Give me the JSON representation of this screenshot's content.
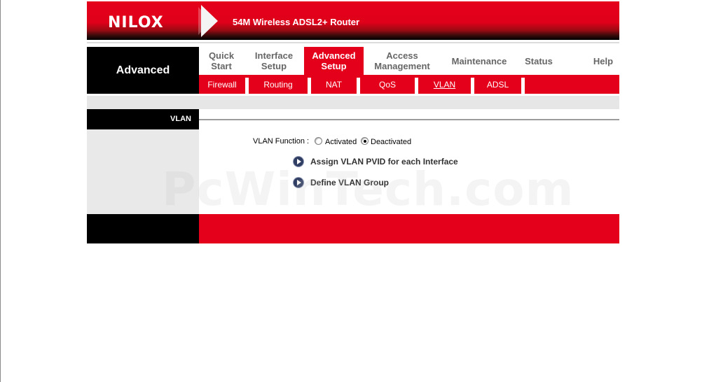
{
  "header": {
    "brand": "NILOX",
    "product": "54M Wireless ADSL2+ Router"
  },
  "section_title": "Advanced",
  "nav": {
    "tabs": [
      {
        "label": "Quick\nStart",
        "active": false
      },
      {
        "label": "Interface\nSetup",
        "active": false
      },
      {
        "label": "Advanced\nSetup",
        "active": true
      },
      {
        "label": "Access\nManagement",
        "active": false
      },
      {
        "label": "Maintenance",
        "active": false
      },
      {
        "label": "Status",
        "active": false
      },
      {
        "label": "Help",
        "active": false
      }
    ],
    "subtabs": [
      {
        "label": "Firewall",
        "active": false
      },
      {
        "label": "Routing",
        "active": false
      },
      {
        "label": "NAT",
        "active": false
      },
      {
        "label": "QoS",
        "active": false
      },
      {
        "label": "VLAN",
        "active": true
      },
      {
        "label": "ADSL",
        "active": false
      }
    ]
  },
  "content": {
    "panel_label": "VLAN",
    "vlan_function_label": "VLAN Function :",
    "options": [
      {
        "label": "Activated",
        "checked": false
      },
      {
        "label": "Deactivated",
        "checked": true
      }
    ],
    "links": [
      {
        "label": "Assign VLAN PVID for each Interface"
      },
      {
        "label": "Define VLAN Group"
      }
    ]
  },
  "watermark": "PcWinTech.com",
  "colors": {
    "brand_red": "#e4001b",
    "black": "#000000",
    "panel_grey": "#e9e9e9",
    "link_icon": "#2f3d62"
  }
}
